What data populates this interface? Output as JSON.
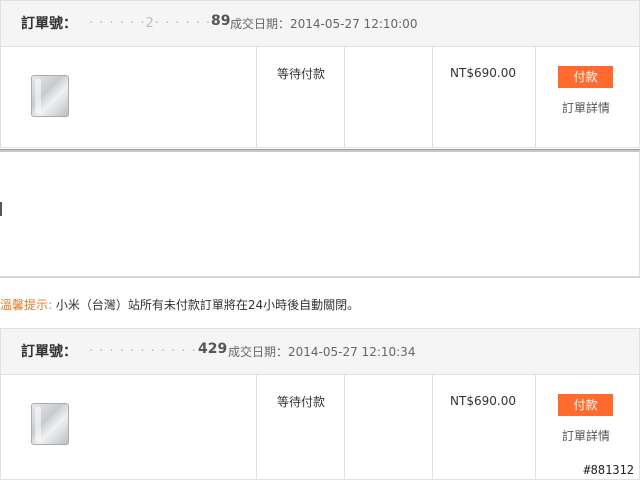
{
  "orders": [
    {
      "label": "訂單號：",
      "number_masked": "· · · · · ·2· · · · · · · ·",
      "number_tail": "89",
      "date_label": "成交日期：2014-05-27 12:10:00",
      "product_icon": "router-silver-icon",
      "status": "等待付款",
      "price": "NT$690.00",
      "pay_label": "付款",
      "detail_label": "訂單詳情"
    },
    {
      "label": "訂單號：",
      "number_masked": "· · · · · · · · · · · · · ·",
      "number_tail": "429",
      "date_label": "成交日期：2014-05-27 12:10:34",
      "product_icon": "router-silver-icon",
      "status": "等待付款",
      "price": "NT$690.00",
      "pay_label": "付款",
      "detail_label": "訂單詳情"
    }
  ],
  "notice": {
    "tip_label": "溫馨提示:",
    "text": " 小米（台灣）站所有未付款訂單將在24小時後自動關閉。"
  },
  "watermark": "#881312",
  "colors": {
    "accent": "#ff6a2e",
    "tip": "#e07b2a",
    "header_bg": "#f5f5f5",
    "border": "#e0e0e0"
  }
}
